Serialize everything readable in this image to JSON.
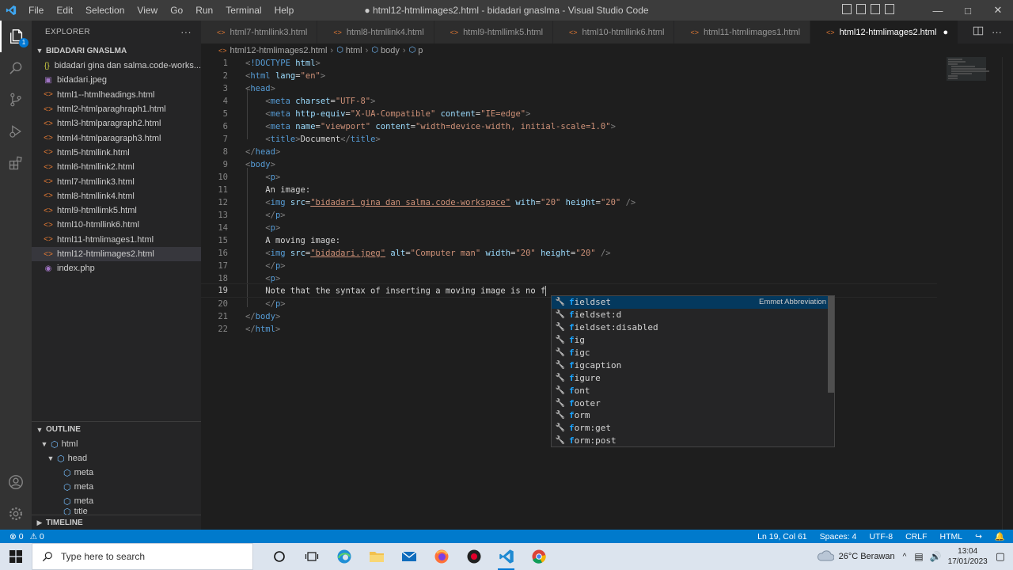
{
  "window": {
    "title": "● html12-htmlimages2.html - bidadari gnaslma - Visual Studio Code",
    "menu": [
      "File",
      "Edit",
      "Selection",
      "View",
      "Go",
      "Run",
      "Terminal",
      "Help"
    ]
  },
  "activity_bar": {
    "items": [
      "explorer-icon",
      "search-icon",
      "source-control-icon",
      "run-debug-icon",
      "extensions-icon"
    ],
    "explorer_badge": "1",
    "bottom": [
      "accounts-icon",
      "manage-gear-icon"
    ]
  },
  "sidebar": {
    "header": "EXPLORER",
    "more": "···",
    "folder": "BIDADARI GNASLMA",
    "files": [
      {
        "icon": "{}",
        "type": "json",
        "name": "bidadari gina dan salma.code-works..."
      },
      {
        "icon": "▣",
        "type": "img",
        "name": "bidadari.jpeg"
      },
      {
        "icon": "<>",
        "type": "html",
        "name": "html1--htmlheadings.html"
      },
      {
        "icon": "<>",
        "type": "html",
        "name": "html2-htmlparaghraph1.html"
      },
      {
        "icon": "<>",
        "type": "html",
        "name": "html3-htmlparagraph2.html"
      },
      {
        "icon": "<>",
        "type": "html",
        "name": "html4-htmlparagraph3.html"
      },
      {
        "icon": "<>",
        "type": "html",
        "name": "html5-htmllink.html"
      },
      {
        "icon": "<>",
        "type": "html",
        "name": "html6-htmllink2.html"
      },
      {
        "icon": "<>",
        "type": "html",
        "name": "html7-htmllink3.html"
      },
      {
        "icon": "<>",
        "type": "html",
        "name": "html8-htmllink4.html"
      },
      {
        "icon": "<>",
        "type": "html",
        "name": "html9-htmllimk5.html"
      },
      {
        "icon": "<>",
        "type": "html",
        "name": "html10-htmllink6.html"
      },
      {
        "icon": "<>",
        "type": "html",
        "name": "html11-htmlimages1.html"
      },
      {
        "icon": "<>",
        "type": "html",
        "name": "html12-htmlimages2.html"
      },
      {
        "icon": "◉",
        "type": "php",
        "name": "index.php"
      }
    ],
    "outline_header": "OUTLINE",
    "outline": [
      "html",
      "head",
      "meta",
      "meta",
      "meta",
      "title"
    ],
    "timeline_header": "TIMELINE"
  },
  "tabs": [
    {
      "name": "html7-htmllink3.html"
    },
    {
      "name": "html8-htmllink4.html"
    },
    {
      "name": "html9-htmllimk5.html"
    },
    {
      "name": "html10-htmllink6.html"
    },
    {
      "name": "html11-htmlimages1.html"
    },
    {
      "name": "html12-htmlimages2.html",
      "dirty": "●"
    }
  ],
  "breadcrumb": [
    "html12-htmlimages2.html",
    "html",
    "body",
    "p"
  ],
  "editor": {
    "line_numbers": [
      "1",
      "2",
      "3",
      "4",
      "5",
      "6",
      "7",
      "8",
      "9",
      "10",
      "11",
      "12",
      "13",
      "14",
      "15",
      "16",
      "17",
      "18",
      "19",
      "20",
      "21",
      "22"
    ],
    "current_line": "19",
    "line11_text": "An image:",
    "line15_text": "A moving image:",
    "line19_text": "Note that the syntax of inserting a moving image is no f",
    "line1": {
      "doctype": "!DOCTYPE",
      "html": "html"
    },
    "line2": {
      "lang_value": "\"en\""
    },
    "line4": {
      "value": "\"UTF-8\""
    },
    "line5": {
      "value1": "\"X-UA-Compatible\"",
      "value2": "\"IE=edge\""
    },
    "line6": {
      "value1": "\"viewport\"",
      "value2": "\"width=device-width, initial-scale=1.0\""
    },
    "line7": {
      "title_text": "Document"
    },
    "line12": {
      "src": "\"bidadari gina dan salma.code-workspace\"",
      "with": "\"20\"",
      "height": "\"20\""
    },
    "line16": {
      "src": "\"bidadari.jpeg\"",
      "alt": "\"Computer man\"",
      "width": "\"20\"",
      "height": "\"20\""
    }
  },
  "suggest": {
    "items": [
      {
        "match": "f",
        "rest": "ieldset",
        "detail": "Emmet Abbreviation"
      },
      {
        "match": "f",
        "rest": "ieldset:d"
      },
      {
        "match": "f",
        "rest": "ieldset:disabled"
      },
      {
        "match": "f",
        "rest": "ig"
      },
      {
        "match": "f",
        "rest": "igc"
      },
      {
        "match": "f",
        "rest": "igcaption"
      },
      {
        "match": "f",
        "rest": "igure"
      },
      {
        "match": "f",
        "rest": "ont"
      },
      {
        "match": "f",
        "rest": "ooter"
      },
      {
        "match": "f",
        "rest": "orm"
      },
      {
        "match": "f",
        "rest": "orm:get"
      },
      {
        "match": "f",
        "rest": "orm:post"
      }
    ]
  },
  "status_bar": {
    "errors": "⊗ 0",
    "warnings": "⚠ 0",
    "position": "Ln 19, Col 61",
    "spaces": "Spaces: 4",
    "encoding": "UTF-8",
    "eol": "CRLF",
    "language": "HTML"
  },
  "taskbar": {
    "search_placeholder": "Type here to search",
    "weather": "26°C Berawan",
    "time": "13:04",
    "date": "17/01/2023"
  },
  "colors": {
    "status_bar": "#007acc",
    "activity_bar": "#333333",
    "sidebar": "#252526",
    "editor": "#1e1e1e",
    "suggest_focus": "#04395e"
  }
}
